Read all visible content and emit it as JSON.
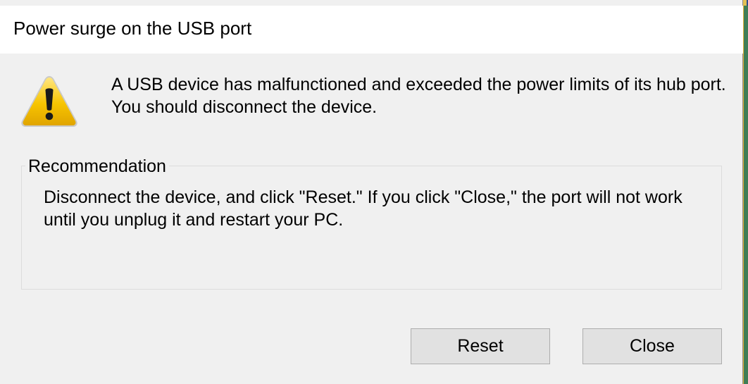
{
  "dialog": {
    "title": "Power surge on the USB port",
    "message": "A USB device has malfunctioned and exceeded the power limits of its hub port. You should disconnect the device.",
    "icon": "warning-icon"
  },
  "recommendation": {
    "legend": "Recommendation",
    "text": "Disconnect the device, and click \"Reset.\" If you click \"Close,\" the port will not work until you unplug it and restart your PC."
  },
  "buttons": {
    "reset_label": "Reset",
    "close_label": "Close"
  },
  "colors": {
    "dialog_background": "#f0f0f0",
    "titlebar_background": "#ffffff",
    "button_background": "#e1e1e1",
    "button_border": "#adadad",
    "warning_yellow": "#f5c400"
  }
}
